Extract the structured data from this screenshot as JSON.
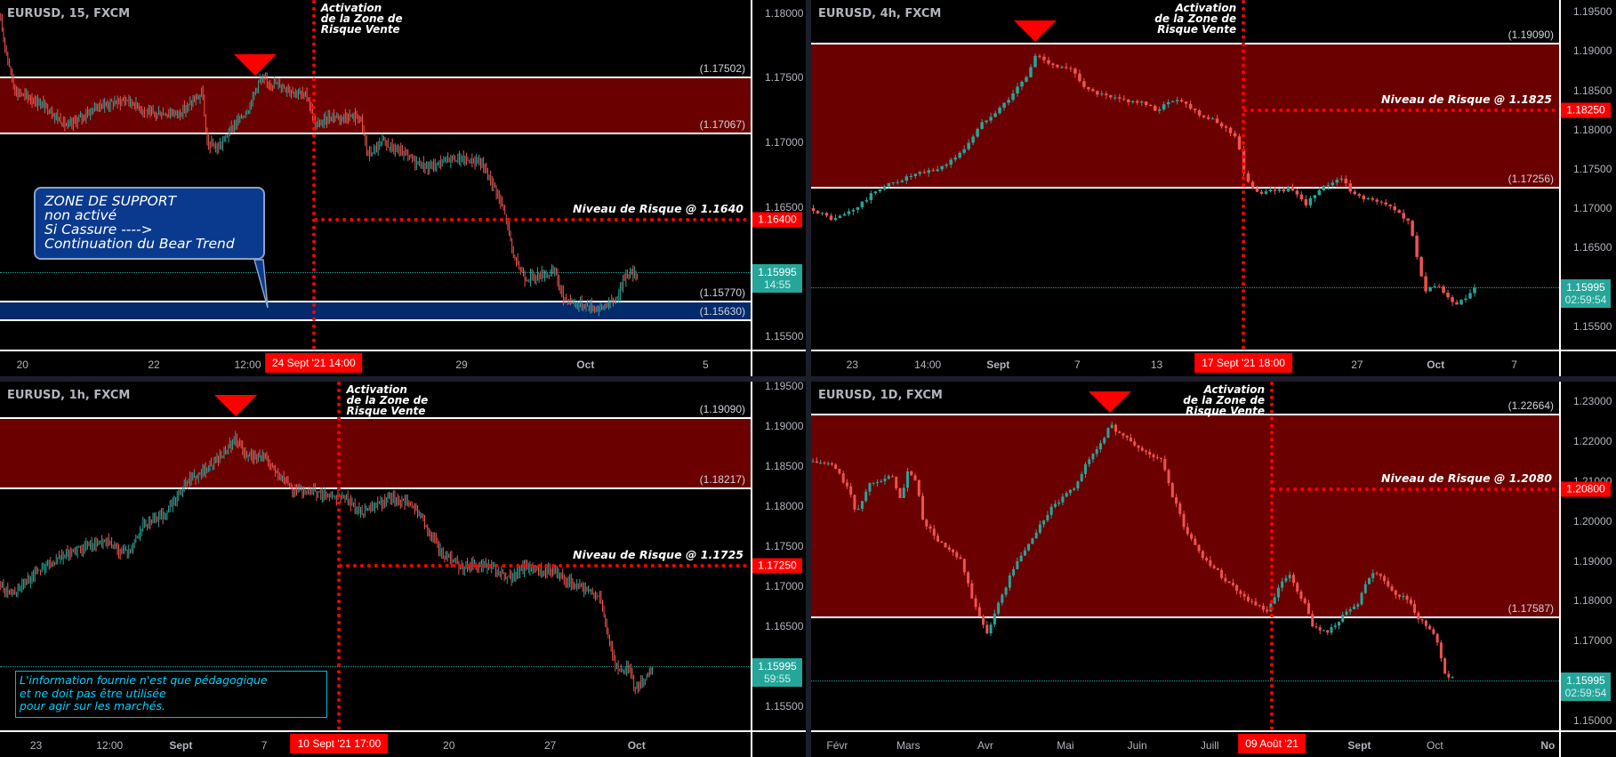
{
  "colors": {
    "up": "#26a69a",
    "down": "#ef5350",
    "zone_fill": "#6b0000",
    "support_fill": "#032a6b",
    "risk": "#ff0000",
    "last_price": "#26a69a",
    "axis_text": "#b2b5be",
    "background": "#000000"
  },
  "chart_data": [
    {
      "type": "candlestick",
      "title": "EURUSD, 15, FXCM",
      "symbol": "EURUSD",
      "timeframe": "15",
      "source": "FXCM",
      "ylim": [
        1.154,
        1.181
      ],
      "yticks": [
        "1.18000",
        "1.17500",
        "1.17000",
        "1.16500",
        "1.15500"
      ],
      "xticks": [
        {
          "label": "20",
          "pos": 0.03,
          "bold": false
        },
        {
          "label": "22",
          "pos": 0.205,
          "bold": false
        },
        {
          "label": "12:00",
          "pos": 0.33,
          "bold": false
        },
        {
          "label": "29",
          "pos": 0.615,
          "bold": false
        },
        {
          "label": "Oct",
          "pos": 0.78,
          "bold": true
        },
        {
          "label": "5",
          "pos": 0.94,
          "bold": false
        }
      ],
      "sell_zone": {
        "top": 1.17502,
        "bottom": 1.17067,
        "top_label": "(1.17502)",
        "bottom_label": "(1.17067)"
      },
      "support_zone": {
        "top": 1.1577,
        "bottom": 1.1563,
        "top_label": "(1.15770)",
        "bottom_label": "(1.15630)"
      },
      "peak_marker": {
        "pos": 0.34
      },
      "activation": {
        "pos": 0.418,
        "text": "Activation\nde la Zone de\nRisque Vente",
        "date_label": "24 Sept '21   14:00",
        "text_side": "right"
      },
      "risk_level": {
        "value": 1.164,
        "text": "Niveau de Risque @ 1.1640",
        "tag": "1.16400",
        "from": 0.418
      },
      "last_price": {
        "value": 1.15995,
        "label": "1.15995",
        "countdown": "14:55"
      },
      "price_path": [
        [
          0.0,
          1.1795
        ],
        [
          0.012,
          1.176
        ],
        [
          0.02,
          1.174
        ],
        [
          0.06,
          1.1728
        ],
        [
          0.09,
          1.1712
        ],
        [
          0.13,
          1.1728
        ],
        [
          0.17,
          1.1733
        ],
        [
          0.2,
          1.1722
        ],
        [
          0.24,
          1.1723
        ],
        [
          0.27,
          1.1738
        ],
        [
          0.275,
          1.17
        ],
        [
          0.29,
          1.1695
        ],
        [
          0.31,
          1.1712
        ],
        [
          0.33,
          1.1725
        ],
        [
          0.345,
          1.1748
        ],
        [
          0.37,
          1.1745
        ],
        [
          0.41,
          1.1735
        ],
        [
          0.42,
          1.1712
        ],
        [
          0.44,
          1.172
        ],
        [
          0.48,
          1.172
        ],
        [
          0.49,
          1.169
        ],
        [
          0.51,
          1.17
        ],
        [
          0.555,
          1.1685
        ],
        [
          0.57,
          1.168
        ],
        [
          0.6,
          1.1688
        ],
        [
          0.64,
          1.1685
        ],
        [
          0.66,
          1.1665
        ],
        [
          0.675,
          1.164
        ],
        [
          0.685,
          1.161
        ],
        [
          0.7,
          1.1595
        ],
        [
          0.74,
          1.16
        ],
        [
          0.75,
          1.158
        ],
        [
          0.77,
          1.1575
        ],
        [
          0.8,
          1.1572
        ],
        [
          0.82,
          1.1578
        ],
        [
          0.835,
          1.16
        ],
        [
          0.85,
          1.1597
        ]
      ]
    },
    {
      "type": "candlestick",
      "title": "EURUSD, 4h, FXCM",
      "symbol": "EURUSD",
      "timeframe": "4h",
      "source": "FXCM",
      "ylim": [
        1.152,
        1.1965
      ],
      "yticks": [
        "1.19500",
        "1.19000",
        "1.18500",
        "1.18000",
        "1.17500",
        "1.17000",
        "1.16500",
        "1.15500"
      ],
      "xticks": [
        {
          "label": "23",
          "pos": 0.055,
          "bold": false
        },
        {
          "label": "14:00",
          "pos": 0.156,
          "bold": false
        },
        {
          "label": "Sept",
          "pos": 0.25,
          "bold": true
        },
        {
          "label": "7",
          "pos": 0.356,
          "bold": false
        },
        {
          "label": "13",
          "pos": 0.462,
          "bold": false
        },
        {
          "label": "27",
          "pos": 0.73,
          "bold": false
        },
        {
          "label": "Oct",
          "pos": 0.835,
          "bold": true
        },
        {
          "label": "7",
          "pos": 0.94,
          "bold": false
        }
      ],
      "sell_zone": {
        "top": 1.1909,
        "bottom": 1.17256,
        "top_label": "(1.19090)",
        "bottom_label": "(1.17256)"
      },
      "peak_marker": {
        "pos": 0.3
      },
      "activation": {
        "pos": 0.578,
        "text": "Activation\nde la Zone de\nRisque Vente",
        "date_label": "17 Sept '21   18:00",
        "text_side": "left"
      },
      "risk_level": {
        "value": 1.1825,
        "text": "Niveau de Risque @ 1.1825",
        "tag": "1.18250",
        "from": 0.578
      },
      "last_price": {
        "value": 1.15995,
        "label": "1.15995",
        "countdown": "02:59:54"
      },
      "candle_count": 150,
      "price_path": [
        [
          0.0,
          1.17
        ],
        [
          0.03,
          1.1685
        ],
        [
          0.06,
          1.17
        ],
        [
          0.09,
          1.1725
        ],
        [
          0.13,
          1.174
        ],
        [
          0.17,
          1.175
        ],
        [
          0.2,
          1.177
        ],
        [
          0.23,
          1.181
        ],
        [
          0.26,
          1.1835
        ],
        [
          0.29,
          1.187
        ],
        [
          0.3,
          1.1895
        ],
        [
          0.33,
          1.188
        ],
        [
          0.35,
          1.1875
        ],
        [
          0.37,
          1.185
        ],
        [
          0.4,
          1.184
        ],
        [
          0.44,
          1.1835
        ],
        [
          0.46,
          1.1825
        ],
        [
          0.49,
          1.184
        ],
        [
          0.52,
          1.182
        ],
        [
          0.55,
          1.1805
        ],
        [
          0.57,
          1.179
        ],
        [
          0.58,
          1.1735
        ],
        [
          0.6,
          1.172
        ],
        [
          0.64,
          1.1725
        ],
        [
          0.66,
          1.1705
        ],
        [
          0.69,
          1.173
        ],
        [
          0.71,
          1.174
        ],
        [
          0.72,
          1.172
        ],
        [
          0.75,
          1.171
        ],
        [
          0.78,
          1.17
        ],
        [
          0.8,
          1.168
        ],
        [
          0.81,
          1.164
        ],
        [
          0.82,
          1.1595
        ],
        [
          0.84,
          1.16
        ],
        [
          0.86,
          1.1575
        ],
        [
          0.875,
          1.1585
        ],
        [
          0.89,
          1.16
        ]
      ]
    },
    {
      "type": "candlestick",
      "title": "EURUSD, 1h, FXCM",
      "symbol": "EURUSD",
      "timeframe": "1h",
      "source": "FXCM",
      "ylim": [
        1.152,
        1.1955
      ],
      "yticks": [
        "1.19500",
        "1.19000",
        "1.18500",
        "1.18000",
        "1.17500",
        "1.17000",
        "1.16500",
        "1.15500"
      ],
      "xticks": [
        {
          "label": "23",
          "pos": 0.048,
          "bold": false
        },
        {
          "label": "12:00",
          "pos": 0.146,
          "bold": false
        },
        {
          "label": "Sept",
          "pos": 0.241,
          "bold": true
        },
        {
          "label": "7",
          "pos": 0.352,
          "bold": false
        },
        {
          "label": "20",
          "pos": 0.598,
          "bold": false
        },
        {
          "label": "27",
          "pos": 0.733,
          "bold": false
        },
        {
          "label": "Oct",
          "pos": 0.848,
          "bold": true
        }
      ],
      "sell_zone": {
        "top": 1.1909,
        "bottom": 1.18217,
        "top_label": "(1.19090)",
        "bottom_label": "(1.18217)"
      },
      "peak_marker": {
        "pos": 0.314
      },
      "activation": {
        "pos": 0.452,
        "text": "Activation\nde la Zone de\nRisque Vente",
        "date_label": "10 Sept '21   17:00",
        "text_side": "right"
      },
      "risk_level": {
        "value": 1.1725,
        "text": "Niveau de Risque @ 1.1725",
        "tag": "1.17250",
        "from": 0.452
      },
      "last_price": {
        "value": 1.15995,
        "label": "1.15995",
        "countdown": "59:55"
      },
      "price_path": [
        [
          0.0,
          1.17
        ],
        [
          0.02,
          1.169
        ],
        [
          0.05,
          1.172
        ],
        [
          0.1,
          1.1745
        ],
        [
          0.14,
          1.1755
        ],
        [
          0.17,
          1.174
        ],
        [
          0.19,
          1.1775
        ],
        [
          0.22,
          1.179
        ],
        [
          0.25,
          1.183
        ],
        [
          0.28,
          1.185
        ],
        [
          0.3,
          1.1865
        ],
        [
          0.314,
          1.1885
        ],
        [
          0.33,
          1.186
        ],
        [
          0.35,
          1.1865
        ],
        [
          0.37,
          1.184
        ],
        [
          0.39,
          1.182
        ],
        [
          0.43,
          1.1815
        ],
        [
          0.46,
          1.181
        ],
        [
          0.48,
          1.179
        ],
        [
          0.52,
          1.181
        ],
        [
          0.55,
          1.18
        ],
        [
          0.57,
          1.177
        ],
        [
          0.59,
          1.174
        ],
        [
          0.61,
          1.1725
        ],
        [
          0.65,
          1.1725
        ],
        [
          0.68,
          1.171
        ],
        [
          0.7,
          1.1725
        ],
        [
          0.74,
          1.1715
        ],
        [
          0.77,
          1.17
        ],
        [
          0.8,
          1.1685
        ],
        [
          0.81,
          1.164
        ],
        [
          0.82,
          1.16
        ],
        [
          0.84,
          1.1595
        ],
        [
          0.845,
          1.157
        ],
        [
          0.86,
          1.1585
        ],
        [
          0.87,
          1.16
        ]
      ]
    },
    {
      "type": "candlestick",
      "title": "EURUSD, 1D, FXCM",
      "symbol": "EURUSD",
      "timeframe": "1D",
      "source": "FXCM",
      "ylim": [
        1.1475,
        1.235
      ],
      "yticks": [
        "1.23000",
        "1.22000",
        "1.21000",
        "1.20000",
        "1.19000",
        "1.18000",
        "1.17000",
        "1.15000"
      ],
      "xticks": [
        {
          "label": "Févr",
          "pos": 0.035,
          "bold": false
        },
        {
          "label": "Mars",
          "pos": 0.13,
          "bold": false
        },
        {
          "label": "Avr",
          "pos": 0.233,
          "bold": false
        },
        {
          "label": "Mai",
          "pos": 0.34,
          "bold": false
        },
        {
          "label": "Juin",
          "pos": 0.436,
          "bold": false
        },
        {
          "label": "Juill",
          "pos": 0.533,
          "bold": false
        },
        {
          "label": "Sept",
          "pos": 0.733,
          "bold": true
        },
        {
          "label": "Oct",
          "pos": 0.834,
          "bold": false
        },
        {
          "label": "No",
          "pos": 0.985,
          "bold": true
        }
      ],
      "sell_zone": {
        "top": 1.22664,
        "bottom": 1.17587,
        "top_label": "(1.22664)",
        "bottom_label": "(1.17587)"
      },
      "peak_marker": {
        "pos": 0.4
      },
      "activation": {
        "pos": 0.616,
        "text": "Activation\nde la Zone de\nRisque Vente",
        "date_label": "09 Août '21",
        "text_side": "left"
      },
      "risk_level": {
        "value": 1.208,
        "text": "Niveau de Risque @ 1.2080",
        "tag": "1.20800",
        "from": 0.616
      },
      "last_price": {
        "value": 1.15995,
        "label": "1.15995",
        "countdown": "02:59:54"
      },
      "candle_count": 170,
      "price_path": [
        [
          0.0,
          1.215
        ],
        [
          0.03,
          1.214
        ],
        [
          0.05,
          1.208
        ],
        [
          0.06,
          1.202
        ],
        [
          0.08,
          1.21
        ],
        [
          0.11,
          1.211
        ],
        [
          0.12,
          1.205
        ],
        [
          0.13,
          1.213
        ],
        [
          0.14,
          1.21
        ],
        [
          0.15,
          1.2
        ],
        [
          0.17,
          1.195
        ],
        [
          0.2,
          1.19
        ],
        [
          0.22,
          1.178
        ],
        [
          0.235,
          1.172
        ],
        [
          0.25,
          1.179
        ],
        [
          0.27,
          1.188
        ],
        [
          0.3,
          1.197
        ],
        [
          0.32,
          1.203
        ],
        [
          0.35,
          1.208
        ],
        [
          0.37,
          1.215
        ],
        [
          0.385,
          1.219
        ],
        [
          0.4,
          1.224
        ],
        [
          0.42,
          1.221
        ],
        [
          0.44,
          1.218
        ],
        [
          0.47,
          1.215
        ],
        [
          0.48,
          1.208
        ],
        [
          0.5,
          1.198
        ],
        [
          0.52,
          1.192
        ],
        [
          0.55,
          1.186
        ],
        [
          0.58,
          1.181
        ],
        [
          0.61,
          1.177
        ],
        [
          0.63,
          1.185
        ],
        [
          0.64,
          1.186
        ],
        [
          0.66,
          1.179
        ],
        [
          0.67,
          1.174
        ],
        [
          0.69,
          1.172
        ],
        [
          0.71,
          1.176
        ],
        [
          0.73,
          1.179
        ],
        [
          0.745,
          1.186
        ],
        [
          0.76,
          1.187
        ],
        [
          0.78,
          1.182
        ],
        [
          0.8,
          1.18
        ],
        [
          0.81,
          1.176
        ],
        [
          0.83,
          1.172
        ],
        [
          0.84,
          1.169
        ],
        [
          0.845,
          1.162
        ],
        [
          0.86,
          1.16
        ]
      ]
    }
  ],
  "support_note": {
    "lines": [
      "ZONE DE SUPPORT",
      "non activé",
      "Si Cassure ---->",
      "Continuation du Bear Trend"
    ]
  },
  "disclaimer": {
    "lines": [
      "L'information fournie n'est que pédagogique",
      "et ne doit pas être utilisée",
      "pour agir sur les marchés."
    ]
  }
}
